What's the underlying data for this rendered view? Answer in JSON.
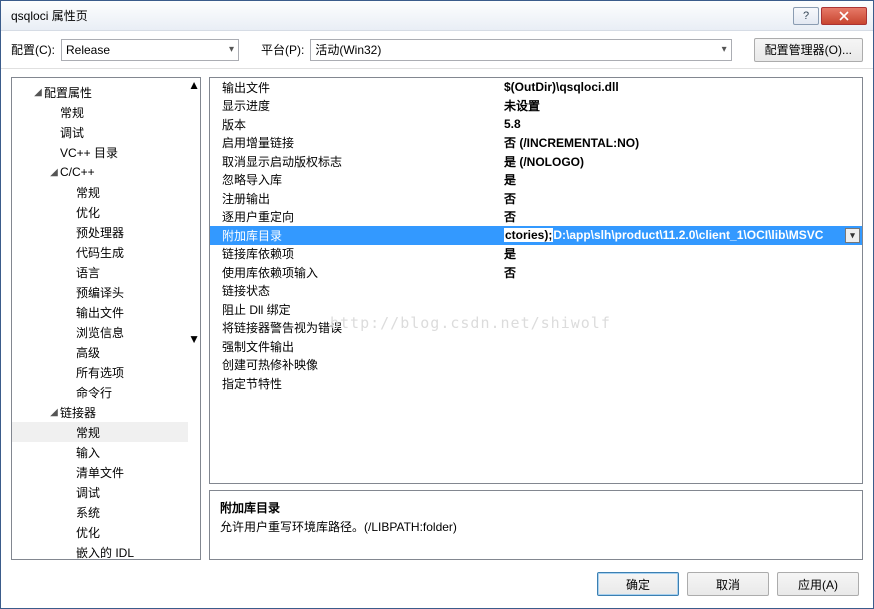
{
  "window": {
    "title": "qsqloci 属性页"
  },
  "config_row": {
    "config_label": "配置(C):",
    "config_value": "Release",
    "platform_label": "平台(P):",
    "platform_value": "活动(Win32)",
    "manager_button": "配置管理器(O)..."
  },
  "tree": [
    {
      "label": "配置属性",
      "indent": 1,
      "caret": "◢"
    },
    {
      "label": "常规",
      "indent": 2
    },
    {
      "label": "调试",
      "indent": 2
    },
    {
      "label": "VC++ 目录",
      "indent": 2
    },
    {
      "label": "C/C++",
      "indent": 2,
      "caret": "◢"
    },
    {
      "label": "常规",
      "indent": 3
    },
    {
      "label": "优化",
      "indent": 3
    },
    {
      "label": "预处理器",
      "indent": 3
    },
    {
      "label": "代码生成",
      "indent": 3
    },
    {
      "label": "语言",
      "indent": 3
    },
    {
      "label": "预编译头",
      "indent": 3
    },
    {
      "label": "输出文件",
      "indent": 3
    },
    {
      "label": "浏览信息",
      "indent": 3
    },
    {
      "label": "高级",
      "indent": 3
    },
    {
      "label": "所有选项",
      "indent": 3
    },
    {
      "label": "命令行",
      "indent": 3
    },
    {
      "label": "链接器",
      "indent": 2,
      "caret": "◢"
    },
    {
      "label": "常规",
      "indent": 3,
      "selected": true
    },
    {
      "label": "输入",
      "indent": 3
    },
    {
      "label": "清单文件",
      "indent": 3
    },
    {
      "label": "调试",
      "indent": 3
    },
    {
      "label": "系统",
      "indent": 3
    },
    {
      "label": "优化",
      "indent": 3
    },
    {
      "label": "嵌入的 IDL",
      "indent": 3
    }
  ],
  "grid": [
    {
      "k": "输出文件",
      "v": "$(OutDir)\\qsqloci.dll"
    },
    {
      "k": "显示进度",
      "v": "未设置"
    },
    {
      "k": "版本",
      "v": "5.8"
    },
    {
      "k": "启用增量链接",
      "v": "否 (/INCREMENTAL:NO)"
    },
    {
      "k": "取消显示启动版权标志",
      "v": "是 (/NOLOGO)"
    },
    {
      "k": "忽略导入库",
      "v": "是"
    },
    {
      "k": "注册输出",
      "v": "否"
    },
    {
      "k": "逐用户重定向",
      "v": "否"
    },
    {
      "k": "附加库目录",
      "v_pre": "ctories);",
      "v": "D:\\app\\slh\\product\\11.2.0\\client_1\\OCI\\lib\\MSVC",
      "selected": true,
      "dropdown": true
    },
    {
      "k": "链接库依赖项",
      "v": "是"
    },
    {
      "k": "使用库依赖项输入",
      "v": "否"
    },
    {
      "k": "链接状态",
      "v": ""
    },
    {
      "k": "阻止 Dll 绑定",
      "v": ""
    },
    {
      "k": "将链接器警告视为错误",
      "v": ""
    },
    {
      "k": "强制文件输出",
      "v": ""
    },
    {
      "k": "创建可热修补映像",
      "v": ""
    },
    {
      "k": "指定节特性",
      "v": ""
    }
  ],
  "description": {
    "title": "附加库目录",
    "body": "允许用户重写环境库路径。(/LIBPATH:folder)"
  },
  "footer": {
    "ok": "确定",
    "cancel": "取消",
    "apply": "应用(A)"
  },
  "watermark": "http://blog.csdn.net/shiwolf"
}
